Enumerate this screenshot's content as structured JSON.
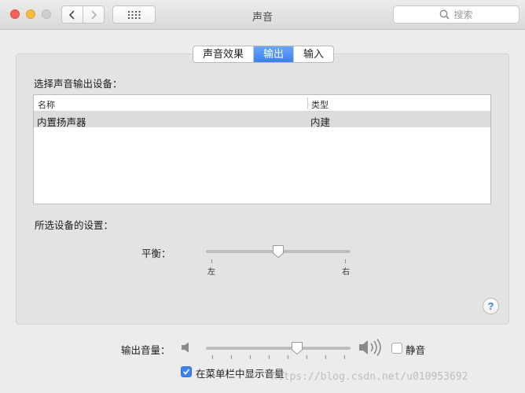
{
  "window": {
    "title": "声音"
  },
  "search": {
    "placeholder": "搜索"
  },
  "tabs": [
    {
      "label": "声音效果",
      "active": false
    },
    {
      "label": "输出",
      "active": true
    },
    {
      "label": "输入",
      "active": false
    }
  ],
  "output": {
    "select_device_label": "选择声音输出设备：",
    "columns": [
      "名称",
      "类型"
    ],
    "devices": [
      {
        "name": "内置扬声器",
        "type": "内建",
        "selected": true
      }
    ],
    "device_settings_label": "所选设备的设置：",
    "balance": {
      "label": "平衡：",
      "left_label": "左",
      "right_label": "右",
      "value": 0.5
    }
  },
  "footer": {
    "volume_label": "输出音量：",
    "volume_value": 0.63,
    "mute_label": "静音",
    "mute_checked": false,
    "show_in_menubar_label": "在菜单栏中显示音量",
    "show_in_menubar_checked": true
  },
  "help": {
    "glyph": "?"
  },
  "watermark": {
    "text": "https://blog.csdn.net/u010953692"
  },
  "colors": {
    "accent": "#3a7ff0",
    "close": "#fc605c",
    "minimize": "#fdbc40"
  }
}
